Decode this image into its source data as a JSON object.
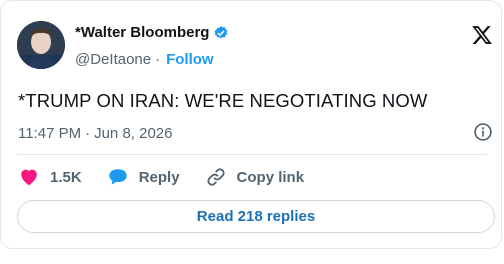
{
  "author": {
    "display_name": "*Walter Bloomberg",
    "handle": "@DeItaone",
    "separator": "·",
    "follow_label": "Follow"
  },
  "tweet": {
    "text": "*TRUMP ON IRAN: WE'RE NEGOTIATING NOW",
    "time": "11:47 PM",
    "dot": "·",
    "date": "Jun 8, 2026"
  },
  "actions": {
    "likes": "1.5K",
    "reply_label": "Reply",
    "copy_link_label": "Copy link"
  },
  "replies_button": "Read 218 replies",
  "colors": {
    "like": "#f91880",
    "reply": "#1d9bf0",
    "verified": "#1d9bf0",
    "link": "#1d71b8"
  },
  "icons": [
    "verified-badge-icon",
    "x-logo-icon",
    "info-icon",
    "heart-icon",
    "reply-bubble-icon",
    "link-icon"
  ]
}
